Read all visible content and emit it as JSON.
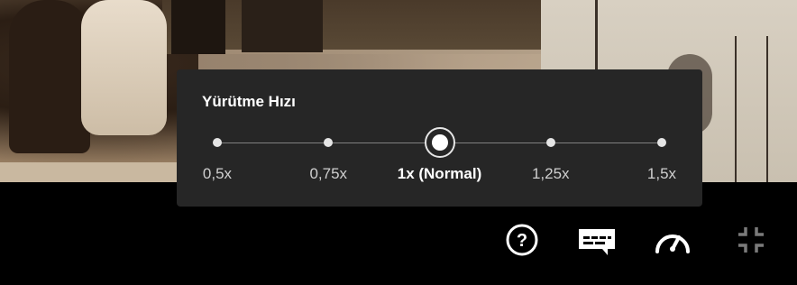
{
  "speed_menu": {
    "title": "Yürütme Hızı",
    "selected_index": 2,
    "options": [
      {
        "label": "0,5x"
      },
      {
        "label": "0,75x"
      },
      {
        "label": "1x (Normal)"
      },
      {
        "label": "1,25x"
      },
      {
        "label": "1,5x"
      }
    ]
  },
  "controls": [
    {
      "name": "help-icon"
    },
    {
      "name": "subtitles-icon"
    },
    {
      "name": "playback-speed-icon"
    },
    {
      "name": "exit-fullscreen-icon"
    }
  ],
  "colors": {
    "popup_background": "#262626",
    "track": "#808080",
    "dot": "#e5e5e5",
    "text_selected": "#ffffff",
    "text_normal": "#cfcfcf",
    "icon_active": "#ffffff",
    "icon_dimmed": "#7a7a7a"
  }
}
